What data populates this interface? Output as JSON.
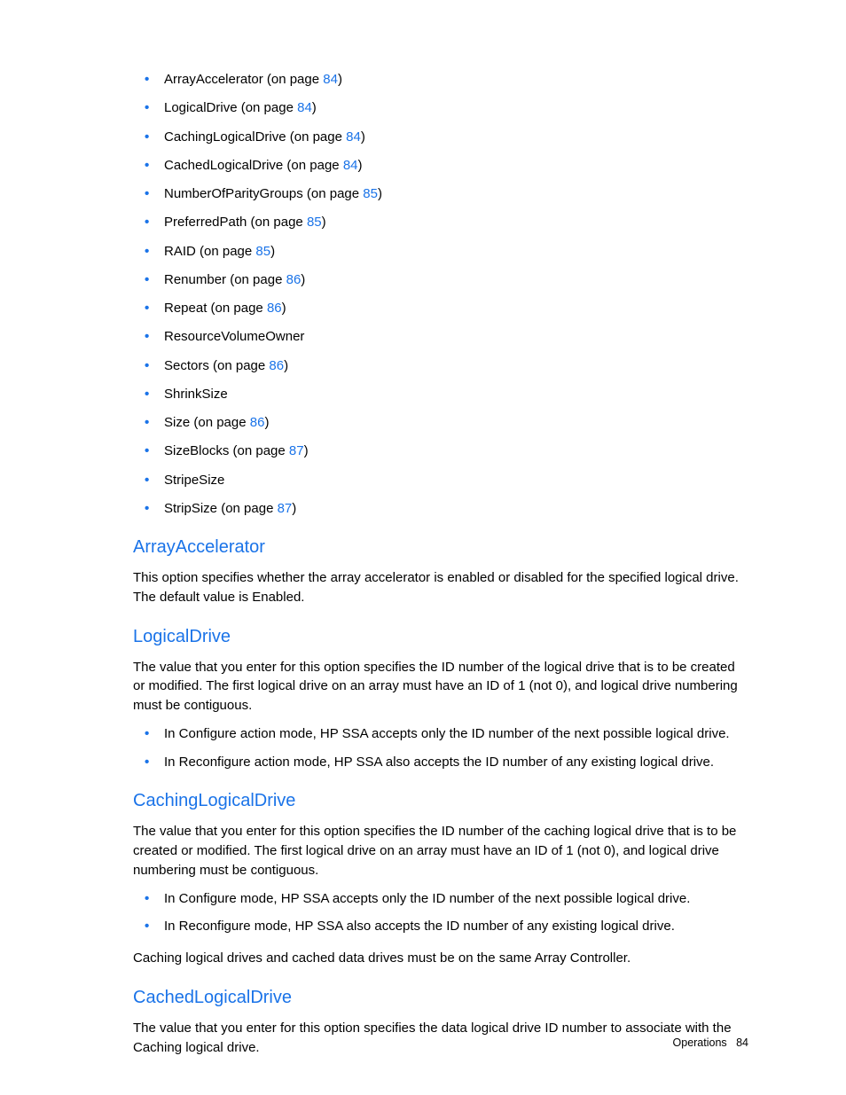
{
  "toc": [
    {
      "label": "ArrayAccelerator",
      "suffix": " (on page ",
      "page": "84",
      "close": ")"
    },
    {
      "label": "LogicalDrive",
      "suffix": " (on page ",
      "page": "84",
      "close": ")"
    },
    {
      "label": "CachingLogicalDrive",
      "suffix": " (on page ",
      "page": "84",
      "close": ")"
    },
    {
      "label": "CachedLogicalDrive",
      "suffix": " (on page ",
      "page": "84",
      "close": ")"
    },
    {
      "label": "NumberOfParityGroups",
      "suffix": " (on page ",
      "page": "85",
      "close": ")"
    },
    {
      "label": "PreferredPath",
      "suffix": " (on page ",
      "page": "85",
      "close": ")"
    },
    {
      "label": "RAID",
      "suffix": " (on page ",
      "page": "85",
      "close": ")"
    },
    {
      "label": "Renumber",
      "suffix": " (on page ",
      "page": "86",
      "close": ")"
    },
    {
      "label": "Repeat",
      "suffix": " (on page ",
      "page": "86",
      "close": ")"
    },
    {
      "label": "ResourceVolumeOwner"
    },
    {
      "label": "Sectors",
      "suffix": " (on page ",
      "page": "86",
      "close": ")"
    },
    {
      "label": "ShrinkSize"
    },
    {
      "label": "Size",
      "suffix": " (on page ",
      "page": "86",
      "close": ")"
    },
    {
      "label": "SizeBlocks",
      "suffix": " (on page ",
      "page": "87",
      "close": ")"
    },
    {
      "label": "StripeSize"
    },
    {
      "label": "StripSize",
      "suffix": " (on page ",
      "page": "87",
      "close": ")"
    }
  ],
  "sections": {
    "arrayaccel": {
      "title": "ArrayAccelerator",
      "p1": "This option specifies whether the array accelerator is enabled or disabled for the specified logical drive. The default value is Enabled."
    },
    "logicaldrive": {
      "title": "LogicalDrive",
      "p1": "The value that you enter for this option specifies the ID number of the logical drive that is to be created or modified. The first logical drive on an array must have an ID of 1 (not 0), and logical drive numbering must be contiguous.",
      "li1": "In Configure action mode, HP SSA accepts only the ID number of the next possible logical drive.",
      "li2": "In Reconfigure action mode, HP SSA also accepts the ID number of any existing logical drive."
    },
    "cachinglogicaldrive": {
      "title": "CachingLogicalDrive",
      "p1": "The value that you enter for this option specifies the ID number of the caching logical drive that is to be created or modified. The first logical drive on an array must have an ID of 1 (not 0), and logical drive numbering must be contiguous.",
      "li1": "In Configure mode, HP SSA accepts only the ID number of the next possible logical drive.",
      "li2": "In Reconfigure mode, HP SSA also accepts the ID number of any existing logical drive.",
      "p2": "Caching logical drives and cached data drives must be on the same Array Controller."
    },
    "cachedlogicaldrive": {
      "title": "CachedLogicalDrive",
      "p1": "The value that you enter for this option specifies the data logical drive ID number to associate with the Caching logical drive."
    }
  },
  "footer": {
    "section": "Operations",
    "page": "84"
  }
}
